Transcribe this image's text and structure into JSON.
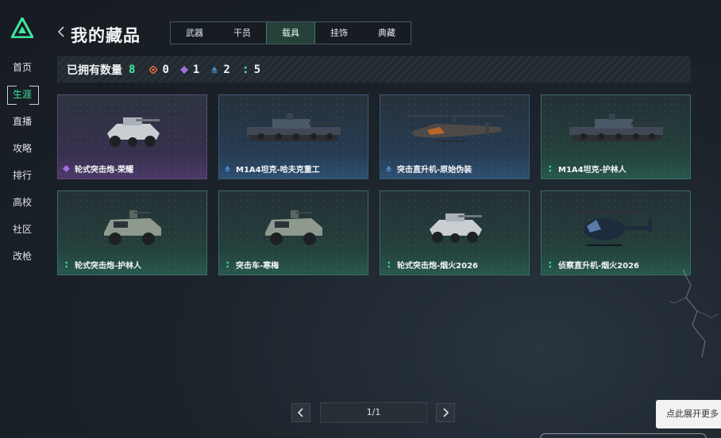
{
  "nav": {
    "items": [
      {
        "label": "首页",
        "active": false
      },
      {
        "label": "生涯",
        "active": true
      },
      {
        "label": "直播",
        "active": false
      },
      {
        "label": "攻略",
        "active": false
      },
      {
        "label": "排行",
        "active": false
      },
      {
        "label": "高校",
        "active": false
      },
      {
        "label": "社区",
        "active": false
      },
      {
        "label": "改枪",
        "active": false
      }
    ]
  },
  "header": {
    "title": "我的藏品",
    "tabs": [
      {
        "label": "武器",
        "active": false
      },
      {
        "label": "干员",
        "active": false
      },
      {
        "label": "载具",
        "active": true
      },
      {
        "label": "挂饰",
        "active": false
      },
      {
        "label": "典藏",
        "active": false
      }
    ]
  },
  "owned": {
    "label": "已拥有数量",
    "total": "8",
    "stats": [
      {
        "icon": "orange-diamond-icon",
        "color": "#e8703a",
        "count": "0"
      },
      {
        "icon": "purple-diamond-icon",
        "color": "#a36ee0",
        "count": "1"
      },
      {
        "icon": "blue-chevron-icon",
        "color": "#4d9be0",
        "count": "2"
      },
      {
        "icon": "green-dots-icon",
        "color": "#3ee89f",
        "count": "5"
      }
    ]
  },
  "cards": [
    {
      "name": "轮式突击炮-荣耀",
      "rarity": "purple",
      "icon": "purple-diamond-icon",
      "vehicle": "wheeled-assault-gun"
    },
    {
      "name": "M1A4坦克-哈夫克重工",
      "rarity": "blue",
      "icon": "blue-chevron-icon",
      "vehicle": "tank"
    },
    {
      "name": "突击直升机-原始伪装",
      "rarity": "blue",
      "icon": "blue-chevron-icon",
      "vehicle": "attack-helicopter"
    },
    {
      "name": "M1A4坦克-护林人",
      "rarity": "green",
      "icon": "green-dots-icon",
      "vehicle": "tank"
    },
    {
      "name": "轮式突击炮-护林人",
      "rarity": "green",
      "icon": "green-dots-icon",
      "vehicle": "armored-car"
    },
    {
      "name": "突击车-寒梅",
      "rarity": "green",
      "icon": "green-dots-icon",
      "vehicle": "armored-car"
    },
    {
      "name": "轮式突击炮-烟火2026",
      "rarity": "green",
      "icon": "green-dots-icon",
      "vehicle": "wheeled-assault-gun"
    },
    {
      "name": "侦察直升机-烟火2026",
      "rarity": "green",
      "icon": "green-dots-icon",
      "vehicle": "scout-helicopter"
    }
  ],
  "pagination": {
    "page": "1/1"
  },
  "expand_button": {
    "label": "点此展开更多"
  },
  "colors": {
    "accent": "#3ee89f",
    "purple": "#a36ee0",
    "blue": "#4d9be0",
    "green": "#3ee89f"
  }
}
